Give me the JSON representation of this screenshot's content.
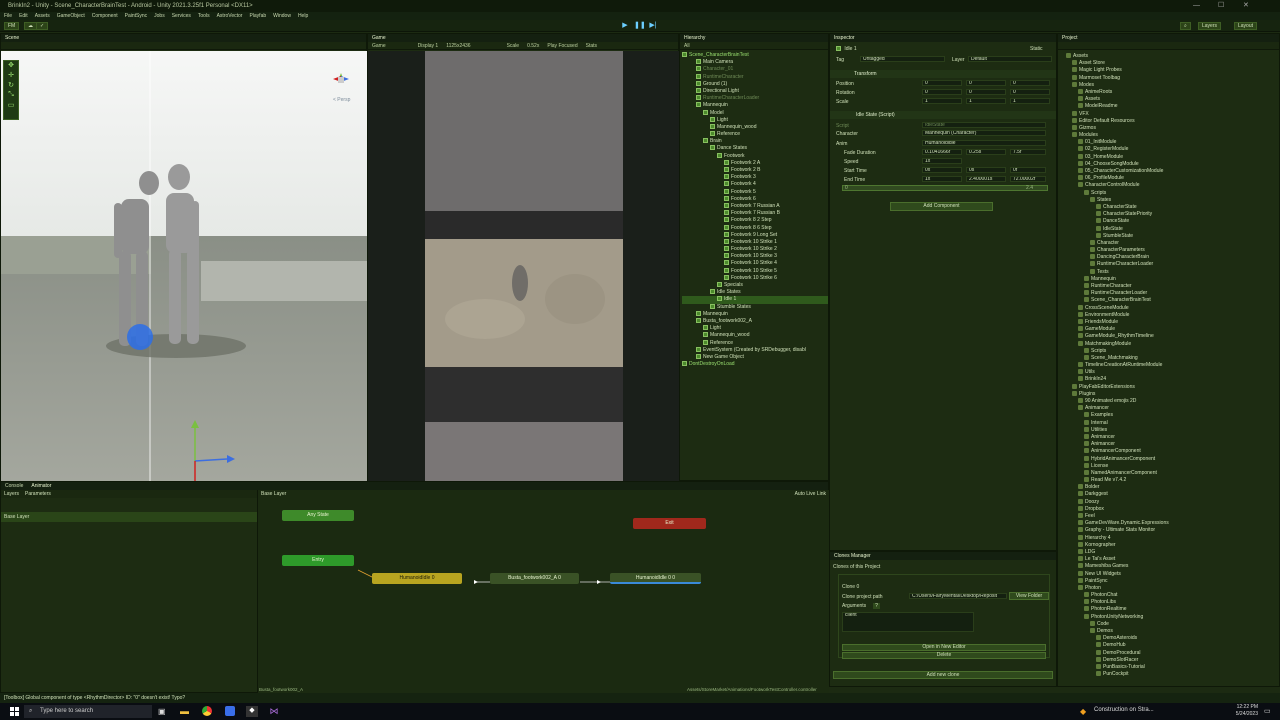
{
  "window": {
    "title": "BrinkIn2 - Unity - Scene_CharacterBrainTest - Android - Unity 2021.3.25f1 Personal <DX11>",
    "controls": [
      "—",
      "☐",
      "✕"
    ]
  },
  "menu": [
    "File",
    "Edit",
    "Assets",
    "GameObject",
    "Component",
    "PaintSync",
    "Jobs",
    "Services",
    "Tools",
    "AstroVector",
    "Playfab",
    "Window",
    "Help"
  ],
  "toolbar": {
    "account": "FM",
    "layers": "Layers",
    "layout": "Layout"
  },
  "scene": {
    "tab": "Scene",
    "persp": "< Persp"
  },
  "game": {
    "tab": "Game",
    "display_mode": "Game",
    "display": "Display 1",
    "resolution": "1125x2436",
    "scale_label": "Scale",
    "scale_value": "0.52x",
    "play_focused": "Play Focused",
    "stats": "Stats"
  },
  "hierarchy": {
    "tab": "Hierarchy",
    "search_placeholder": "All",
    "items": [
      {
        "text": "Scene_CharacterBrainTest",
        "indent": 0,
        "icon": "unity-scene-icon",
        "style": "hl"
      },
      {
        "text": "Main Camera",
        "indent": 2,
        "icon": "cube-icon",
        "style": ""
      },
      {
        "text": "Character_01",
        "indent": 2,
        "icon": "cube-icon",
        "style": "dim"
      },
      {
        "text": "RuntimeCharacter",
        "indent": 2,
        "icon": "cube-icon",
        "style": "dim"
      },
      {
        "text": "Ground (1)",
        "indent": 2,
        "icon": "cube-icon",
        "style": ""
      },
      {
        "text": "Directional Light",
        "indent": 2,
        "icon": "cube-icon",
        "style": ""
      },
      {
        "text": "RuntimeCharacterLoader",
        "indent": 2,
        "icon": "cube-icon",
        "style": "dim"
      },
      {
        "text": "Mannequin",
        "indent": 2,
        "icon": "cube-icon",
        "style": ""
      },
      {
        "text": "Model",
        "indent": 3,
        "icon": "cube-icon",
        "style": ""
      },
      {
        "text": "Light",
        "indent": 4,
        "icon": "cube-icon",
        "style": ""
      },
      {
        "text": "Mannequin_wood",
        "indent": 4,
        "icon": "cube-icon",
        "style": ""
      },
      {
        "text": "Reference",
        "indent": 4,
        "icon": "cube-icon",
        "style": ""
      },
      {
        "text": "Brain",
        "indent": 3,
        "icon": "cube-icon",
        "style": ""
      },
      {
        "text": "Dance States",
        "indent": 4,
        "icon": "cube-icon",
        "style": ""
      },
      {
        "text": "Footwork",
        "indent": 5,
        "icon": "cube-icon",
        "style": ""
      },
      {
        "text": "Footwork 2 A",
        "indent": 6,
        "icon": "cube-icon",
        "style": ""
      },
      {
        "text": "Footwork 2 B",
        "indent": 6,
        "icon": "cube-icon",
        "style": ""
      },
      {
        "text": "Footwork 3",
        "indent": 6,
        "icon": "cube-icon",
        "style": ""
      },
      {
        "text": "Footwork 4",
        "indent": 6,
        "icon": "cube-icon",
        "style": ""
      },
      {
        "text": "Footwork 5",
        "indent": 6,
        "icon": "cube-icon",
        "style": ""
      },
      {
        "text": "Footwork 6",
        "indent": 6,
        "icon": "cube-icon",
        "style": ""
      },
      {
        "text": "Footwork 7 Russian A",
        "indent": 6,
        "icon": "cube-icon",
        "style": ""
      },
      {
        "text": "Footwork 7 Russian B",
        "indent": 6,
        "icon": "cube-icon",
        "style": ""
      },
      {
        "text": "Footwork 8 2 Step",
        "indent": 6,
        "icon": "cube-icon",
        "style": ""
      },
      {
        "text": "Footwork 8 6 Step",
        "indent": 6,
        "icon": "cube-icon",
        "style": ""
      },
      {
        "text": "Footwork 9 Long Set",
        "indent": 6,
        "icon": "cube-icon",
        "style": ""
      },
      {
        "text": "Footwork 10 Strike 1",
        "indent": 6,
        "icon": "cube-icon",
        "style": ""
      },
      {
        "text": "Footwork 10 Strike 2",
        "indent": 6,
        "icon": "cube-icon",
        "style": ""
      },
      {
        "text": "Footwork 10 Strike 3",
        "indent": 6,
        "icon": "cube-icon",
        "style": ""
      },
      {
        "text": "Footwork 10 Strike 4",
        "indent": 6,
        "icon": "cube-icon",
        "style": ""
      },
      {
        "text": "Footwork 10 Strike 5",
        "indent": 6,
        "icon": "cube-icon",
        "style": ""
      },
      {
        "text": "Footwork 10 Strike 6",
        "indent": 6,
        "icon": "cube-icon",
        "style": ""
      },
      {
        "text": "Specials",
        "indent": 5,
        "icon": "cube-icon",
        "style": ""
      },
      {
        "text": "Idle States",
        "indent": 4,
        "icon": "cube-icon",
        "style": ""
      },
      {
        "text": "Idle 1",
        "indent": 5,
        "icon": "cube-icon",
        "style": "sel"
      },
      {
        "text": "Stumble States",
        "indent": 4,
        "icon": "cube-icon",
        "style": ""
      },
      {
        "text": "Mannequin",
        "indent": 2,
        "icon": "cube-icon",
        "style": ""
      },
      {
        "text": "Busta_footwork002_A",
        "indent": 2,
        "icon": "cube-icon",
        "style": ""
      },
      {
        "text": "Light",
        "indent": 3,
        "icon": "cube-icon",
        "style": ""
      },
      {
        "text": "Mannequin_wood",
        "indent": 3,
        "icon": "cube-icon",
        "style": ""
      },
      {
        "text": "Reference",
        "indent": 3,
        "icon": "cube-icon",
        "style": ""
      },
      {
        "text": "EventSystem (Created by SRDebugger, disabl",
        "indent": 2,
        "icon": "cube-icon",
        "style": ""
      },
      {
        "text": "New Game Object",
        "indent": 2,
        "icon": "cube-icon",
        "style": ""
      },
      {
        "text": "DontDestroyOnLoad",
        "indent": 0,
        "icon": "unity-scene-icon",
        "style": "hl"
      }
    ]
  },
  "inspector": {
    "tab": "Inspector",
    "object_name": "Idle 1",
    "static": "Static",
    "tag_label": "Tag",
    "tag_value": "Untagged",
    "layer_label": "Layer",
    "layer_value": "Default",
    "transform": {
      "header": "Transform",
      "rows": [
        {
          "label": "Position",
          "x": "0",
          "y": "0",
          "z": "0"
        },
        {
          "label": "Rotation",
          "x": "0",
          "y": "0",
          "z": "0"
        },
        {
          "label": "Scale",
          "x": "1",
          "y": "1",
          "z": "1"
        }
      ]
    },
    "script": {
      "header": "Idle State (Script)",
      "script_label": "Script",
      "script_value": "IdleState",
      "character_label": "Character",
      "character_value": "Mannequin (Character)",
      "anim_label": "Anim",
      "anim_value": "Humanoididle",
      "fade_label": "Fade Duration",
      "fade_values": [
        "0.1041666r",
        "0.25s",
        "7.5f"
      ],
      "speed_label": "Speed",
      "speed_value": "1x",
      "start_label": "Start Time",
      "start_values": [
        "0x",
        "0s",
        "0f"
      ],
      "end_label": "End Time",
      "end_values": [
        "1x",
        "2.400001s",
        "72.00002f"
      ],
      "timeline_start": "0",
      "timeline_end": "2.4"
    },
    "add_component": "Add Component"
  },
  "clones": {
    "tab": "Clones Manager",
    "heading": "Clones of this Project",
    "clone_name": "Clone 0",
    "path_label": "Clone project path",
    "path_value": "C:/Users/FairyMental/Desktop/Reposit",
    "view_folder": "View Folder",
    "arguments_label": "Arguments",
    "arguments_value": "client",
    "open_editor": "Open in New Editor",
    "delete": "Delete",
    "add_clone": "Add new clone"
  },
  "project": {
    "tab": "Project",
    "items": [
      {
        "text": "Assets",
        "indent": 0
      },
      {
        "text": "Asset Store",
        "indent": 1
      },
      {
        "text": "Magic Light Probes",
        "indent": 1
      },
      {
        "text": "Marmoset Toolbag",
        "indent": 1
      },
      {
        "text": "Modes",
        "indent": 1
      },
      {
        "text": "AnimeRoots",
        "indent": 2
      },
      {
        "text": "Assets",
        "indent": 2
      },
      {
        "text": "ModelReadme",
        "indent": 2
      },
      {
        "text": "VFX",
        "indent": 1
      },
      {
        "text": "Editor Default Resources",
        "indent": 1
      },
      {
        "text": "Gizmos",
        "indent": 1
      },
      {
        "text": "Modules",
        "indent": 1
      },
      {
        "text": "01_InitModule",
        "indent": 2
      },
      {
        "text": "02_RegisterModule",
        "indent": 2
      },
      {
        "text": "03_HomeModule",
        "indent": 2
      },
      {
        "text": "04_ChooseSongModule",
        "indent": 2
      },
      {
        "text": "05_CharacterCustomizationModule",
        "indent": 2
      },
      {
        "text": "06_ProfileModule",
        "indent": 2
      },
      {
        "text": "CharacterControlModule",
        "indent": 2
      },
      {
        "text": "Scripts",
        "indent": 3
      },
      {
        "text": "States",
        "indent": 4
      },
      {
        "text": "CharacterState",
        "indent": 5
      },
      {
        "text": "CharacterStatePriority",
        "indent": 5
      },
      {
        "text": "DanceState",
        "indent": 5
      },
      {
        "text": "IdleState",
        "indent": 5
      },
      {
        "text": "StumbleState",
        "indent": 5
      },
      {
        "text": "Character",
        "indent": 4
      },
      {
        "text": "CharacterParameters",
        "indent": 4
      },
      {
        "text": "DancingCharacterBrain",
        "indent": 4
      },
      {
        "text": "RuntimeCharacterLoader",
        "indent": 4
      },
      {
        "text": "Tests",
        "indent": 4
      },
      {
        "text": "Mannequin",
        "indent": 3
      },
      {
        "text": "RuntimeCharacter",
        "indent": 3
      },
      {
        "text": "RuntimeCharacterLoader",
        "indent": 3
      },
      {
        "text": "Scene_CharacterBrainTest",
        "indent": 3
      },
      {
        "text": "CrossSceneModule",
        "indent": 2
      },
      {
        "text": "EnvironmentModule",
        "indent": 2
      },
      {
        "text": "FriendsModule",
        "indent": 2
      },
      {
        "text": "GameModule",
        "indent": 2
      },
      {
        "text": "GameModule_RhythmTimeline",
        "indent": 2
      },
      {
        "text": "MatchmakingModule",
        "indent": 2
      },
      {
        "text": "Scripts",
        "indent": 3
      },
      {
        "text": "Scene_Matchmaking",
        "indent": 3
      },
      {
        "text": "TimelineCreationAtRuntimeModule",
        "indent": 2
      },
      {
        "text": "Utils",
        "indent": 2
      },
      {
        "text": "BrinkIn24",
        "indent": 2
      },
      {
        "text": "PlayFabEditorExtensions",
        "indent": 1
      },
      {
        "text": "Plugins",
        "indent": 1
      },
      {
        "text": "90 Animated emojis 2D",
        "indent": 2
      },
      {
        "text": "Animancer",
        "indent": 2
      },
      {
        "text": "Examples",
        "indent": 3
      },
      {
        "text": "Internal",
        "indent": 3
      },
      {
        "text": "Utilities",
        "indent": 3
      },
      {
        "text": "Animancer",
        "indent": 3
      },
      {
        "text": "Animancer",
        "indent": 3
      },
      {
        "text": "AnimancerComponent",
        "indent": 3
      },
      {
        "text": "HybridAnimancerComponent",
        "indent": 3
      },
      {
        "text": "License",
        "indent": 3
      },
      {
        "text": "NamedAnimancerComponent",
        "indent": 3
      },
      {
        "text": "Read Me v7.4.2",
        "indent": 3
      },
      {
        "text": "Bolder",
        "indent": 2
      },
      {
        "text": "Darkggest",
        "indent": 2
      },
      {
        "text": "Doozy",
        "indent": 2
      },
      {
        "text": "Dropbox",
        "indent": 2
      },
      {
        "text": "Feel",
        "indent": 2
      },
      {
        "text": "GameDevWare.Dynamic.Expressions",
        "indent": 2
      },
      {
        "text": "Graphy - Ultimate Stats Monitor",
        "indent": 2
      },
      {
        "text": "Hierarchy 4",
        "indent": 2
      },
      {
        "text": "Kornographer",
        "indent": 2
      },
      {
        "text": "LDG",
        "indent": 2
      },
      {
        "text": "Le Tai's Asset",
        "indent": 2
      },
      {
        "text": "Mameshiba Games",
        "indent": 2
      },
      {
        "text": "New UI Widgets",
        "indent": 2
      },
      {
        "text": "PaintSync",
        "indent": 2
      },
      {
        "text": "Photon",
        "indent": 2
      },
      {
        "text": "PhotonChat",
        "indent": 3
      },
      {
        "text": "PhotonLibs",
        "indent": 3
      },
      {
        "text": "PhotonRealtime",
        "indent": 3
      },
      {
        "text": "PhotonUnityNetworking",
        "indent": 3
      },
      {
        "text": "Code",
        "indent": 4
      },
      {
        "text": "Demos",
        "indent": 4
      },
      {
        "text": "DemoAsteroids",
        "indent": 5
      },
      {
        "text": "DemoHub",
        "indent": 5
      },
      {
        "text": "DemoProcedural",
        "indent": 5
      },
      {
        "text": "DemoSlotRacer",
        "indent": 5
      },
      {
        "text": "PunBasics-Tutorial",
        "indent": 5
      },
      {
        "text": "PunCockpit",
        "indent": 5
      }
    ]
  },
  "console_animator": {
    "tabs": [
      "Console",
      "Animator"
    ],
    "sub_tabs": [
      "Layers",
      "Parameters"
    ],
    "layer_name": "Base Layer",
    "breadcrumb": "Base Layer",
    "auto_live_link": "Auto Live Link",
    "nodes": {
      "any_state": "Any State",
      "exit": "Exit",
      "entry": "Entry",
      "idle_a": "HumanoidIdle 0",
      "busta": "Busta_footwork002_A 0",
      "idle_b": "HumanoidIdle 0 0"
    },
    "footer_left": "Busta_footwork002_A",
    "footer_right": "Assets/StoreMarket/Animations/FootworkTestController.controller"
  },
  "status_bar": {
    "message": "[Toolbox] Global component of type <RhythmDirector> ID: \"0\" doesn't exist! Typo?"
  },
  "taskbar": {
    "search_placeholder": "Type here to search",
    "weather": "Construction on Stra...",
    "time": "12:22 PM",
    "date": "5/24/2023"
  }
}
